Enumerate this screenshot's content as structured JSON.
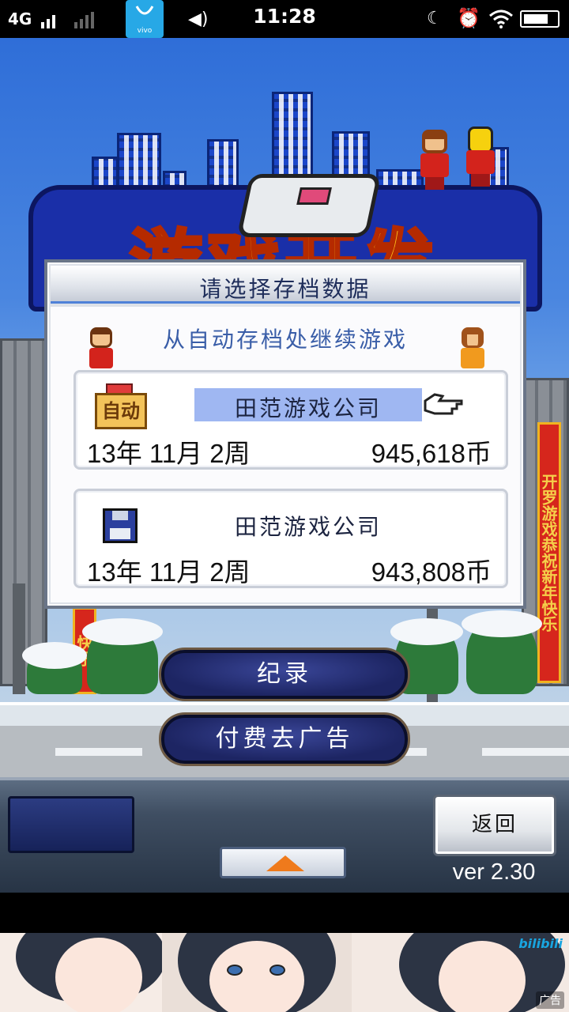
{
  "status_bar": {
    "network": "4G",
    "time": "11:28",
    "vivo_label": "vivo",
    "battery_level": 0.78
  },
  "logo": {
    "title": "游戏开发"
  },
  "dialog": {
    "title": "请选择存档数据",
    "autosave_heading": "从自动存档处继续游戏",
    "slots": [
      {
        "badge": "自动",
        "company": "田范游戏公司",
        "date": "13年 11月 2周",
        "money": "945,618币",
        "selected": true
      },
      {
        "company": "田范游戏公司",
        "date": "13年 11月 2周",
        "money": "943,808币",
        "selected": false
      }
    ]
  },
  "buttons": {
    "records": "纪录",
    "no_ads": "付费去广告",
    "back": "返回"
  },
  "banners": {
    "left": "快乐",
    "right": "开罗游戏恭祝新年快乐"
  },
  "version": "ver 2.30",
  "ad": {
    "mark": "广告",
    "brand": "bilibili"
  }
}
